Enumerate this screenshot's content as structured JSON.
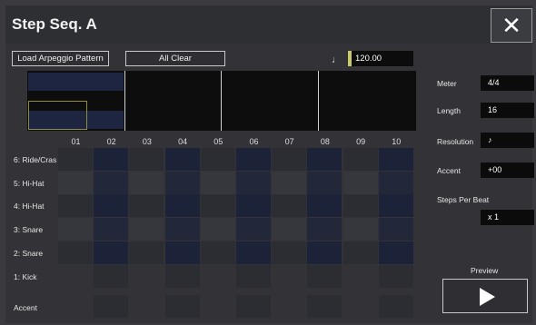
{
  "window": {
    "title": "Step Seq. A",
    "close_icon": "✕"
  },
  "toolbar": {
    "load_label": "Load Arpeggio Pattern",
    "clear_label": "All Clear",
    "tempo_icon": "♩",
    "tempo_value": "120.00"
  },
  "grid": {
    "step_headers": [
      "01",
      "02",
      "03",
      "04",
      "05",
      "06",
      "07",
      "08",
      "09",
      "10"
    ],
    "rows": [
      "6: Ride/Cras",
      "5: Hi-Hat",
      "4: Hi-Hat",
      "3: Snare",
      "2: Snare",
      "1: Kick"
    ],
    "accent_label": "Accent"
  },
  "params": {
    "meter_label": "Meter",
    "meter_value": "4/4",
    "length_label": "Length",
    "length_value": "16",
    "resolution_label": "Resolution",
    "resolution_value": "♪",
    "accent_label": "Accent",
    "accent_value": "+00",
    "spb_label": "Steps Per Beat",
    "spb_value": "x 1"
  },
  "preview": {
    "label": "Preview",
    "icon": "play-icon"
  },
  "colors": {
    "accent_yellow": "#c9c96b",
    "range_outline": "#8c8d3a",
    "cell_dark_navy": "#1c2238",
    "cell_navy": "#222839",
    "cell_gray": "#2c2c33",
    "cell_light": "#36363d"
  }
}
